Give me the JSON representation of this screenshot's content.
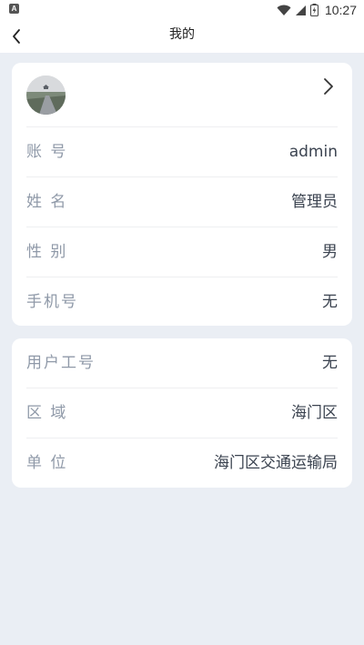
{
  "status_bar": {
    "notification_icon": "a-app-icon",
    "icons": [
      "wifi-icon",
      "signal-icon",
      "battery-icon"
    ],
    "time": "10:27"
  },
  "header": {
    "title": "我的",
    "back_icon": "chevron-left-icon"
  },
  "profile_card": {
    "avatar": "avatar-image",
    "chevron_icon": "chevron-right-icon",
    "fields": [
      {
        "label": "账 号",
        "value": "admin"
      },
      {
        "label": "姓 名",
        "value": "管理员"
      },
      {
        "label": "性 别",
        "value": "男"
      },
      {
        "label": "手机号",
        "value": "无"
      }
    ]
  },
  "work_card": {
    "fields": [
      {
        "label": "用户工号",
        "value": "无"
      },
      {
        "label": "区 域",
        "value": "海门区"
      },
      {
        "label": "单 位",
        "value": "海门区交通运输局"
      }
    ]
  },
  "colors": {
    "background": "#eaeef4",
    "card": "#ffffff",
    "label": "#8f99a8",
    "value": "#3b4350"
  }
}
